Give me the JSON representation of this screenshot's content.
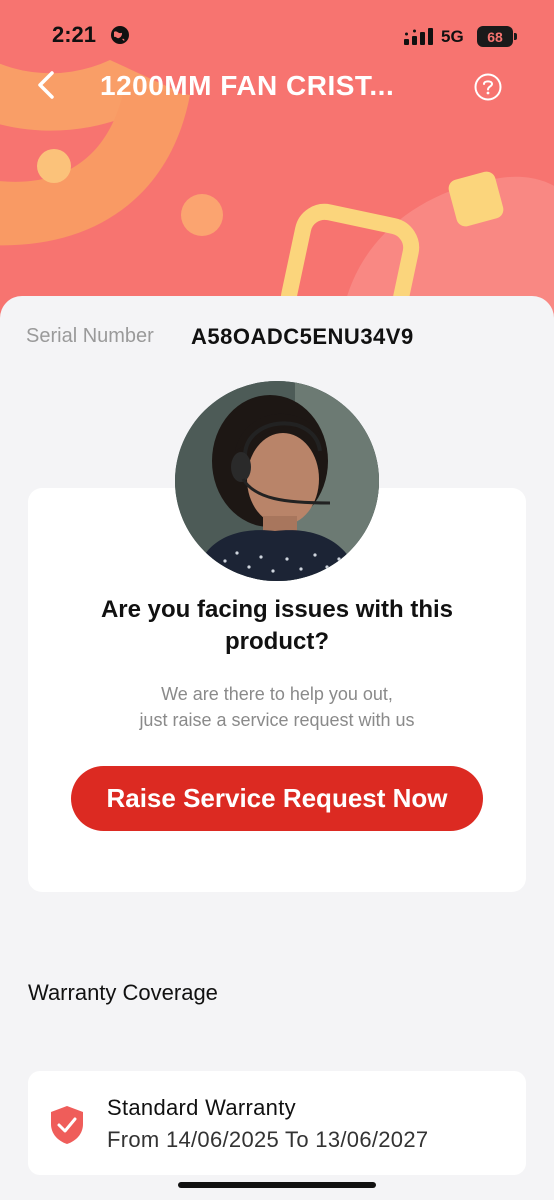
{
  "status_bar": {
    "time": "2:21",
    "network": "5G",
    "battery": "68"
  },
  "header": {
    "title": "1200MM FAN CRIST..."
  },
  "product": {
    "serial_label": "Serial Number",
    "serial_value": "A58OADC5ENU34V9"
  },
  "support": {
    "heading": "Are you facing issues with this product?",
    "line1": "We are there to help you out,",
    "line2": "just raise a service request with us",
    "button_label": "Raise Service Request Now"
  },
  "warranty": {
    "heading": "Warranty Coverage",
    "items": [
      {
        "title": "Standard Warranty",
        "dates": "From 14/06/2025 To 13/06/2027"
      }
    ]
  },
  "colors": {
    "header_bg": "#f77470",
    "accent_button": "#dc2a22",
    "shield": "#ef5d5a"
  },
  "icons": {
    "back": "chevron-left-icon",
    "help": "question-circle-icon",
    "warranty": "shield-check-icon"
  }
}
